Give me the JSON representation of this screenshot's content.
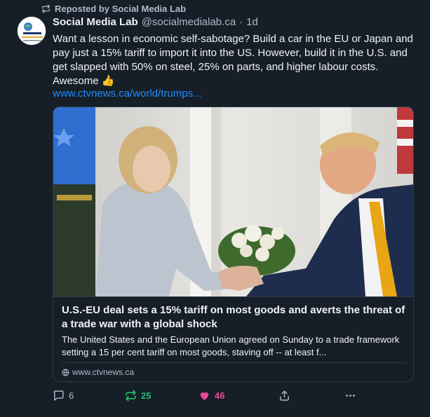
{
  "repost": {
    "text": "Reposted by Social Media Lab"
  },
  "author": {
    "name": "Social Media Lab",
    "handle": "@socialmedialab.ca",
    "separator": "·",
    "time": "1d",
    "avatar_text": "SocialMediaLab.ca"
  },
  "post": {
    "text": "Want a lesson in economic self-sabotage? Build a car in the EU or Japan and pay just a 15% tariff to import it into the US. However, build it in the U.S. and get slapped with 50% on steel, 25% on parts, and higher labour costs. Awesome 👍",
    "link": "www.ctvnews.ca/world/trumps..."
  },
  "card": {
    "title": "U.S.-EU deal sets a 15% tariff on most goods and averts the threat of a trade war with a global shock",
    "description": "The United States and the European Union agreed on Sunday to a trade framework setting a 15 per cent tariff on most goods, staving off -- at least f...",
    "source": "www.ctvnews.ca"
  },
  "actions": {
    "reply_count": "6",
    "repost_count": "25",
    "like_count": "46"
  },
  "colors": {
    "background": "#161e27",
    "link": "#208bfe",
    "repost_active": "#20bc6b",
    "like_active": "#ec4899",
    "muted": "#aebbc9"
  },
  "icons": [
    "repost-icon",
    "reply-icon",
    "heart-icon",
    "share-icon",
    "more-icon",
    "globe-icon"
  ]
}
